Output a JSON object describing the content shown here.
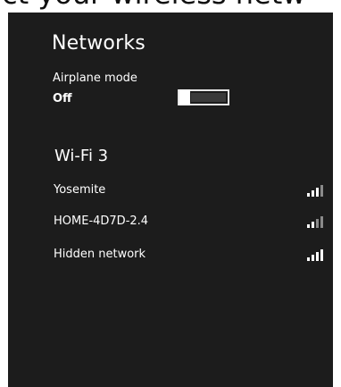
{
  "background_caption": "ct your wireless netw",
  "panel": {
    "title": "Networks",
    "airplane_mode": {
      "label": "Airplane mode",
      "state": "Off",
      "enabled": false
    },
    "wifi_section": {
      "title": "Wi-Fi 3",
      "networks": [
        {
          "name": "Yosemite",
          "signal_bars": 4,
          "strong_bars": 3
        },
        {
          "name": "HOME-4D7D-2.4",
          "signal_bars": 4,
          "strong_bars": 2
        },
        {
          "name": "Hidden network",
          "signal_bars": 4,
          "strong_bars": 4
        }
      ]
    }
  },
  "colors": {
    "panel_bg": "#1c1c1c",
    "text": "#ffffff",
    "toggle_off": "#3a3a3a",
    "signal_dim": "#8a8a8a"
  }
}
